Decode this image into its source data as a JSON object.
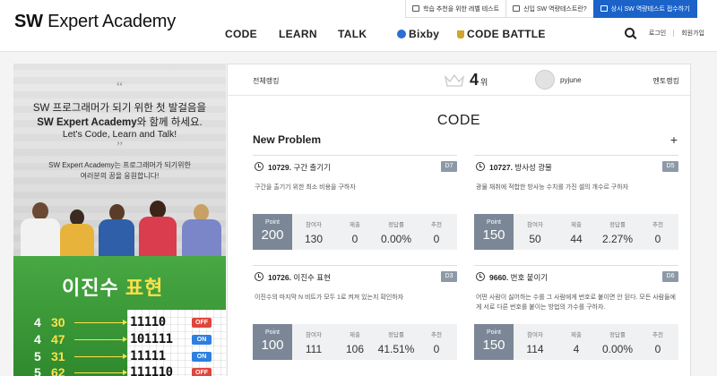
{
  "header": {
    "logo_bold": "SW",
    "logo_rest": " Expert Academy",
    "top_buttons": [
      {
        "label": "학습 추천을 위한 레벨 테스트",
        "icon": "check-icon"
      },
      {
        "label": "신입 SW 역량테스트란?",
        "icon": "monitor-icon"
      },
      {
        "label": "상시 SW 역량테스트 접수하기",
        "icon": "document-icon"
      }
    ],
    "nav": [
      "CODE",
      "LEARN",
      "TALK",
      "Bixby",
      "CODE BATTLE"
    ],
    "login": "로그인",
    "signup": "회원가입"
  },
  "banner": {
    "line1": "SW 프로그래머가 되기 위한 첫 발걸음을",
    "line2_bold": "SW Expert Academy",
    "line2_rest": "와 함께 하세요.",
    "line3": "Let's Code, Learn and Talk!",
    "sub1": "SW Expert Academy는 프로그래머가 되기위한",
    "sub2": "여러분의 꿈을 응원합니다!"
  },
  "banner2": {
    "title_part1": "이진수 ",
    "title_part2": "표현",
    "rows": [
      {
        "n": "4",
        "m": "30",
        "bits": "11110",
        "tag": "OFF",
        "status": "off"
      },
      {
        "n": "4",
        "m": "47",
        "bits": "101111",
        "tag": "ON",
        "status": "on"
      },
      {
        "n": "5",
        "m": "31",
        "bits": "11111",
        "tag": "ON",
        "status": "on"
      },
      {
        "n": "5",
        "m": "62",
        "bits": "111110",
        "tag": "OFF",
        "status": "off"
      }
    ]
  },
  "ranking": {
    "overall": "전체랭킹",
    "rank_value": "4",
    "rank_unit": "위",
    "username": "pyjune",
    "mentor": "멘토랭킹"
  },
  "code": {
    "title": "CODE",
    "new_problem": "New Problem",
    "plus": "+",
    "stat_labels": {
      "point": "Point",
      "participants": "참여자",
      "submissions": "제출",
      "accuracy": "정답률",
      "recommend": "추천"
    },
    "problems": [
      {
        "num": "10729.",
        "name": "구간 출기기",
        "level": "D7",
        "desc": "구간을 출기기 위한 최소 비용을 구하자",
        "point": "200",
        "participants": "130",
        "submissions": "0",
        "accuracy": "0.00%",
        "recommend": "0"
      },
      {
        "num": "10727.",
        "name": "방사성 광물",
        "level": "D5",
        "desc": "광물 채취에 적합한 방사능 수치를 가진 셀의 개수르 구하자",
        "point": "150",
        "participants": "50",
        "submissions": "44",
        "accuracy": "2.27%",
        "recommend": "0"
      },
      {
        "num": "10726.",
        "name": "이진수 표현",
        "level": "D3",
        "desc": "이진수의 마지막 N 비트가 모두 1로 켜져 있는지 확인하자",
        "point": "100",
        "participants": "111",
        "submissions": "106",
        "accuracy": "41.51%",
        "recommend": "0"
      },
      {
        "num": "9660.",
        "name": "번호 붙이기",
        "level": "D6",
        "desc": "어떤 사람이 싫어하는 수를 그 사람에게 번호로 붙이면 안 된다. 모든 사람들에게 서로 다른 번호를 붙이는 방법의 가수를 구하자.",
        "point": "150",
        "participants": "114",
        "submissions": "4",
        "accuracy": "0.00%",
        "recommend": "0"
      }
    ]
  },
  "colors": {
    "accent": "#1b63c9",
    "point_bg": "#7b8796",
    "level_bg": "#8e99a8",
    "banner_green": "#3f9a3a"
  }
}
